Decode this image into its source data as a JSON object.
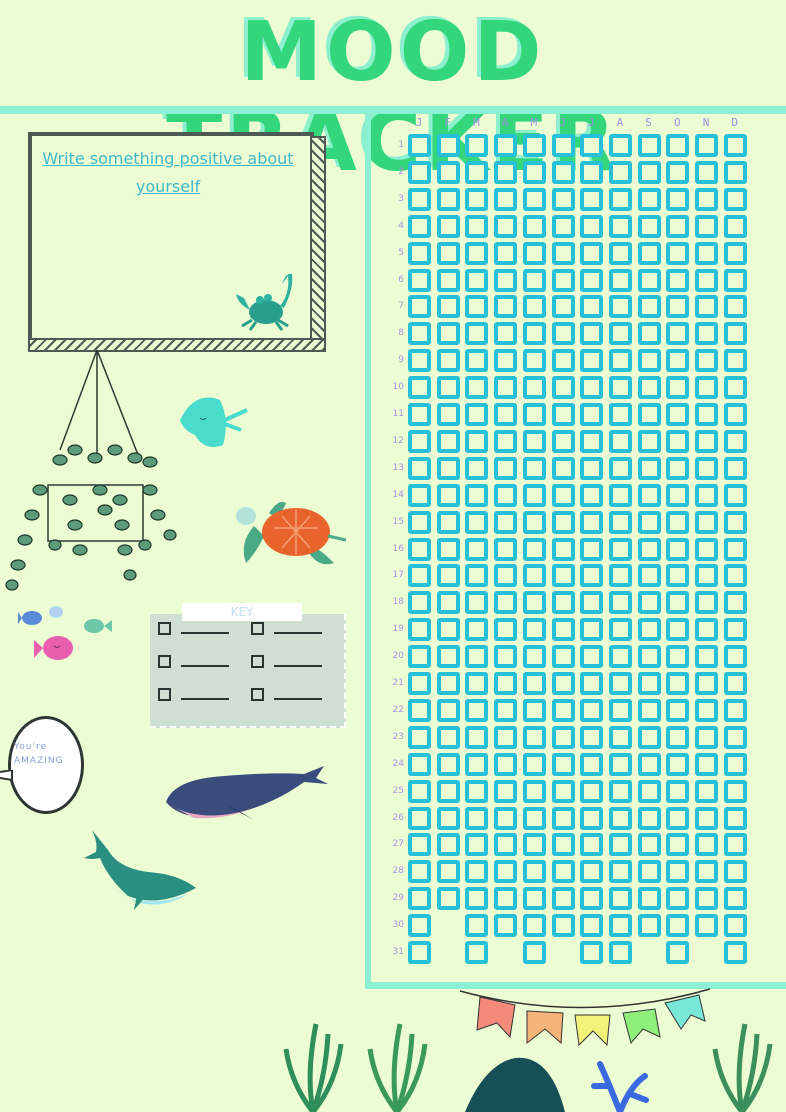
{
  "title": "MOOD TRACKER",
  "prompt_box": {
    "text": "Write something positive about yourself"
  },
  "tracker": {
    "months": [
      "J",
      "F",
      "M",
      "A",
      "M",
      "J",
      "J",
      "A",
      "S",
      "O",
      "N",
      "D"
    ],
    "days": [
      1,
      2,
      3,
      4,
      5,
      6,
      7,
      8,
      9,
      10,
      11,
      12,
      13,
      14,
      15,
      16,
      17,
      18,
      19,
      20,
      21,
      22,
      23,
      24,
      25,
      26,
      27,
      28,
      29,
      30,
      31
    ],
    "month_day_counts": [
      31,
      29,
      31,
      30,
      31,
      30,
      31,
      31,
      30,
      31,
      30,
      31
    ]
  },
  "key": {
    "title": "KEY",
    "items": [
      "",
      "",
      "",
      "",
      "",
      ""
    ]
  },
  "speech_bubble": {
    "line1": "You're",
    "line2": "AMAZING"
  },
  "decorations": [
    "crab-sticker",
    "hanging-plant",
    "stingray-sticker",
    "sea-turtle-sticker",
    "fish-stickers",
    "whale-sticker",
    "dolphin-sticker",
    "bunting-flags",
    "seaweed",
    "rock",
    "coral"
  ],
  "colors": {
    "background": "#ecfcd3",
    "title": "#33d67a",
    "title_shadow": "#8cf0cf",
    "grid_cell": "#26c1d8",
    "month_label": "#9e8fe0",
    "divider": "#8cf0d4",
    "prompt_text": "#3fb9c9"
  }
}
